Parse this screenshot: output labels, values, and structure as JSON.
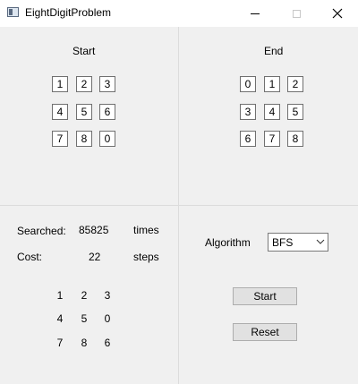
{
  "window": {
    "title": "EightDigitProblem"
  },
  "start_panel": {
    "label": "Start",
    "tiles": [
      "1",
      "2",
      "3",
      "4",
      "5",
      "6",
      "7",
      "8",
      "0"
    ]
  },
  "end_panel": {
    "label": "End",
    "tiles": [
      "0",
      "1",
      "2",
      "3",
      "4",
      "5",
      "6",
      "7",
      "8"
    ]
  },
  "stats": {
    "searched_label": "Searched:",
    "searched_value": "85825",
    "searched_unit": "times",
    "cost_label": "Cost:",
    "cost_value": "22",
    "cost_unit": "steps"
  },
  "result_grid": [
    "1",
    "2",
    "3",
    "4",
    "5",
    "0",
    "7",
    "8",
    "6"
  ],
  "controls": {
    "algorithm_label": "Algorithm",
    "algorithm_selected": "BFS",
    "start_button": "Start",
    "reset_button": "Reset"
  }
}
